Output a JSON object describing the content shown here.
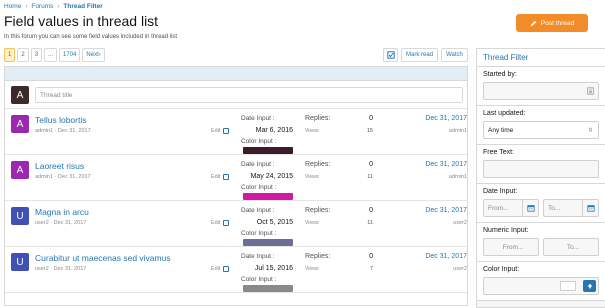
{
  "breadcrumb": {
    "items": [
      "Home",
      "Forums",
      "Thread Filter"
    ]
  },
  "page": {
    "title": "Field values in thread list",
    "description": "In this forum you can see some field values included in thread list",
    "post_button": "Post thread"
  },
  "pagination": {
    "pages": [
      "1",
      "2",
      "3",
      "...",
      "1704"
    ],
    "next": "Next›"
  },
  "toolbar": {
    "mark_read": "Mark read",
    "watch": "Watch"
  },
  "new_thread": {
    "avatar_letter": "A",
    "placeholder": "Thread title"
  },
  "labels": {
    "date_input": "Date Input :",
    "color_input": "Color Input :",
    "replies": "Replies:",
    "views": "Views:",
    "edit": "Edit"
  },
  "threads": [
    {
      "letter": "A",
      "avatar_color": "#9c27b0",
      "title": "Tellus lobortis",
      "meta": "admin1 · Dec 31, 2017",
      "date_input": "Mar 6, 2016",
      "color": "#3a1c2a",
      "replies": "0",
      "views": "15",
      "last_date": "Dec 31, 2017",
      "last_user": "admin1"
    },
    {
      "letter": "A",
      "avatar_color": "#9c27b0",
      "title": "Laoreet risus",
      "meta": "admin1 · Dec 31, 2017",
      "date_input": "May 24, 2015",
      "color": "#d318a2",
      "replies": "0",
      "views": "11",
      "last_date": "Dec 31, 2017",
      "last_user": "admin1"
    },
    {
      "letter": "U",
      "avatar_color": "#3f51b5",
      "title": "Magna in arcu",
      "meta": "user2 · Dec 31, 2017",
      "date_input": "Oct 5, 2015",
      "color": "#6b6f98",
      "replies": "0",
      "views": "11",
      "last_date": "Dec 31, 2017",
      "last_user": "user2"
    },
    {
      "letter": "U",
      "avatar_color": "#3f51b5",
      "title": "Curabitur ut maecenas sed vivamus",
      "meta": "user2 · Dec 31, 2017",
      "date_input": "Jul 15, 2016",
      "color": "#8a8a8a",
      "replies": "0",
      "views": "7",
      "last_date": "Dec 31, 2017",
      "last_user": "user2"
    }
  ],
  "filter": {
    "title": "Thread Filter",
    "started_by": "Started by:",
    "last_updated": "Last updated:",
    "last_updated_value": "Any time",
    "free_text": "Free Text:",
    "date_input": "Date Input:",
    "date_from": "From...",
    "date_to": "To...",
    "numeric_input": "Numeric Input:",
    "numeric_from": "From...",
    "numeric_to": "To...",
    "color_input": "Color Input:"
  },
  "colors": {
    "accent": "#2577b1",
    "post_button": "#f28c28",
    "page_current": "#fef0c7"
  }
}
